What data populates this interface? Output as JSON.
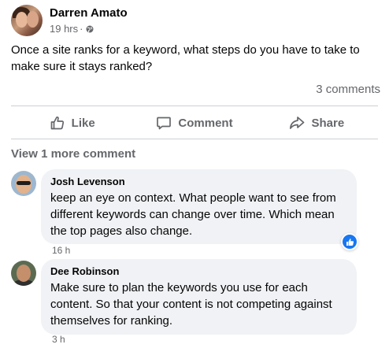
{
  "post": {
    "author": "Darren Amato",
    "time": "19 hrs",
    "separator": "·",
    "text": "Once a site ranks for a keyword, what steps do you have to take to make sure it stays ranked?",
    "comment_count": "3 comments"
  },
  "actions": {
    "like": "Like",
    "comment": "Comment",
    "share": "Share"
  },
  "view_more": "View 1 more comment",
  "comments": [
    {
      "name": "Josh Levenson",
      "text": "keep an eye on context. What people want to see from different keywords can change over time. Which mean the top pages also change.",
      "time": "16 h",
      "reaction": "like-icon"
    },
    {
      "name": "Dee Robinson",
      "text": "Make sure to plan the keywords you use for each content. So that your content is not competing against themselves for ranking.",
      "time": "3 h"
    }
  ],
  "colors": {
    "primary_text": "#050505",
    "secondary_text": "#65676b",
    "bubble_bg": "#f0f2f5",
    "like_blue": "#1877f2",
    "divider": "#ced0d4"
  }
}
